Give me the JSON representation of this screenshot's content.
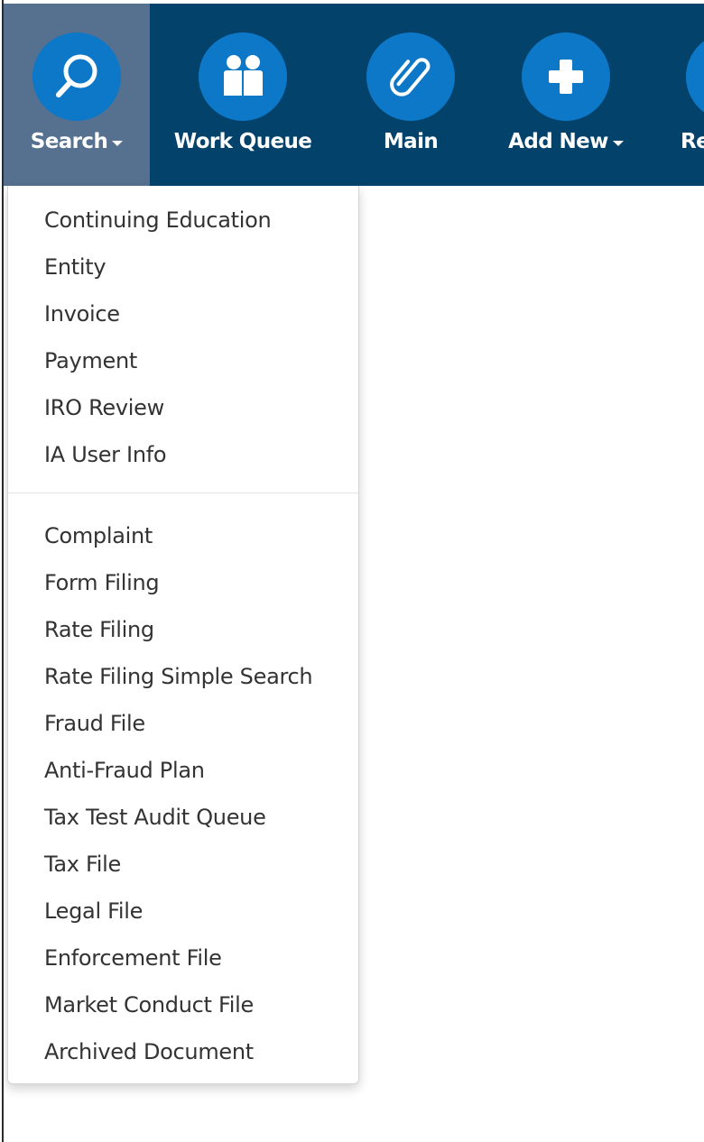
{
  "navbar": {
    "items": [
      {
        "label": "Search",
        "icon": "search-icon",
        "has_caret": true,
        "active": true
      },
      {
        "label": "Work Queue",
        "icon": "users-icon",
        "has_caret": false,
        "active": false
      },
      {
        "label": "Main",
        "icon": "paperclip-icon",
        "has_caret": false,
        "active": false
      },
      {
        "label": "Add New",
        "icon": "plus-icon",
        "has_caret": true,
        "active": false
      },
      {
        "label": "Re",
        "icon": "partial-icon",
        "has_caret": false,
        "active": false
      }
    ]
  },
  "dropdown": {
    "group1": [
      "Continuing Education",
      "Entity",
      "Invoice",
      "Payment",
      "IRO Review",
      "IA User Info"
    ],
    "group2": [
      "Complaint",
      "Form Filing",
      "Rate Filing",
      "Rate Filing Simple Search",
      "Fraud File",
      "Anti-Fraud Plan",
      "Tax Test Audit Queue",
      "Tax File",
      "Legal File",
      "Enforcement File",
      "Market Conduct File",
      "Archived Document"
    ]
  },
  "colors": {
    "navbar_bg": "#02426b",
    "active_bg": "#55718f",
    "icon_circle": "#0c78c7",
    "menu_text": "#333333"
  }
}
